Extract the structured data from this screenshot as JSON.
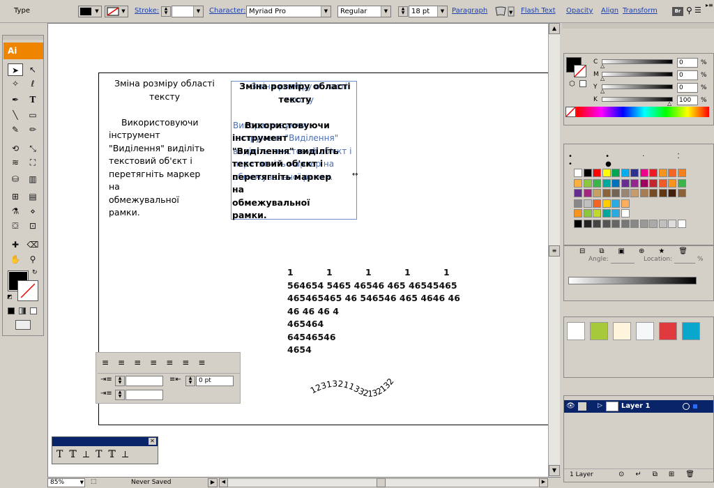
{
  "control_bar": {
    "mode_label": "Type",
    "stroke_label": "Stroke:",
    "character_label": "Character:",
    "font_family": "Myriad Pro",
    "font_style": "Regular",
    "font_size": "18 pt",
    "paragraph_label": "Paragraph",
    "flash_text_label": "Flash Text",
    "opacity_label": "Opacity",
    "align_label": "Align",
    "transform_label": "Transform",
    "bridge_label": "Br"
  },
  "toolbox": {
    "logo": "Ai"
  },
  "artboard": {
    "text_block_1": [
      "Зміна розміру області",
      "тексту",
      "",
      "Використовуючи",
      "інструмент",
      "\"Виділення\" виділіть",
      "текстовий об'єкт і",
      "перетягніть маркер",
      "на",
      "обмежувальної",
      "рамки."
    ],
    "text_block_2": [
      "Зміна розміру області",
      "тексту",
      "",
      "Використовуючи",
      "інструмент",
      "\"Виділення\" виділіть",
      "текстовий об'єкт і",
      "перетягніть маркер",
      "на",
      "обмежувальної",
      "рамки."
    ],
    "text_ghost": [
      "Зміна розміру області",
      "тексту",
      "",
      "Використовуючи",
      "інструмент \"Виділення\"",
      "виділіть текстовий об'єкт і",
      "перетягніть маркер на",
      "обмежувальної рамки."
    ],
    "numbers": {
      "header": [
        "1",
        "1",
        "1",
        "1",
        "1"
      ],
      "lines": [
        "564654 5465 46546 465 46545465",
        "465465465 46 546546 465 4646 46",
        "46 46 46 4",
        "465464",
        "64546546",
        "4654"
      ]
    },
    "path_text": "12313211332132132"
  },
  "paragraph_panel": {
    "right_indent_value": "0 pt"
  },
  "color_panel": {
    "labels": [
      "C",
      "M",
      "Y",
      "K"
    ],
    "values": [
      "0",
      "0",
      "0",
      "100"
    ],
    "percent": "%"
  },
  "gradient_panel": {
    "angle_label": "Angle:",
    "location_label": "Location:",
    "percent": "%"
  },
  "layers_panel": {
    "layer_name": "Layer 1",
    "layer_count": "1 Layer"
  },
  "status_bar": {
    "zoom": "85%",
    "state": "Never Saved"
  },
  "colors": {
    "accent": "#ef8400",
    "layers_selected": "#0a246a",
    "link": "#1a3fae",
    "ghost_text": "#4a6fb4"
  }
}
